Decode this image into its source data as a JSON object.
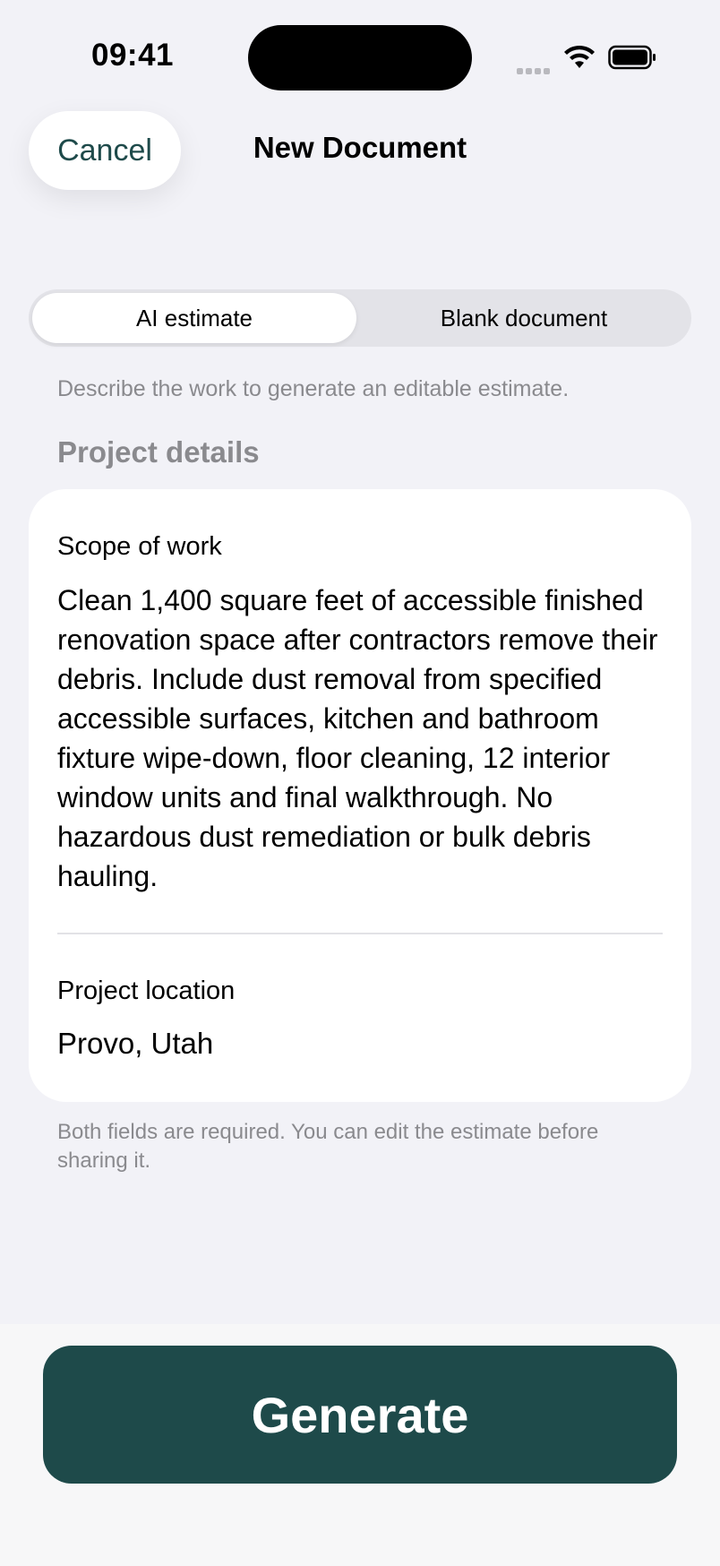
{
  "status_bar": {
    "time": "09:41",
    "icons": [
      "signal-icon",
      "wifi-icon",
      "battery-icon"
    ]
  },
  "nav": {
    "cancel_label": "Cancel",
    "title": "New Document"
  },
  "segmented": {
    "options": [
      "AI estimate",
      "Blank document"
    ],
    "selected": "AI estimate"
  },
  "helper_text": "Describe the work to generate an editable estimate.",
  "section_header": "Project details",
  "form": {
    "scope_label": "Scope of work",
    "scope_value": "Clean 1,400 square feet of accessible finished renovation space after contractors remove their debris. Include dust removal from specified accessible surfaces, kitchen and bathroom fixture wipe-down, floor cleaning, 12 interior window units and final walkthrough. No hazardous dust remediation or bulk debris hauling.",
    "location_label": "Project location",
    "location_value": "Provo, Utah"
  },
  "footnote": "Both fields are required. You can edit the estimate before sharing it.",
  "generate_label": "Generate",
  "colors": {
    "accent": "#1e4a4a",
    "background": "#f2f2f7",
    "secondary_text": "#8a8a8e"
  }
}
